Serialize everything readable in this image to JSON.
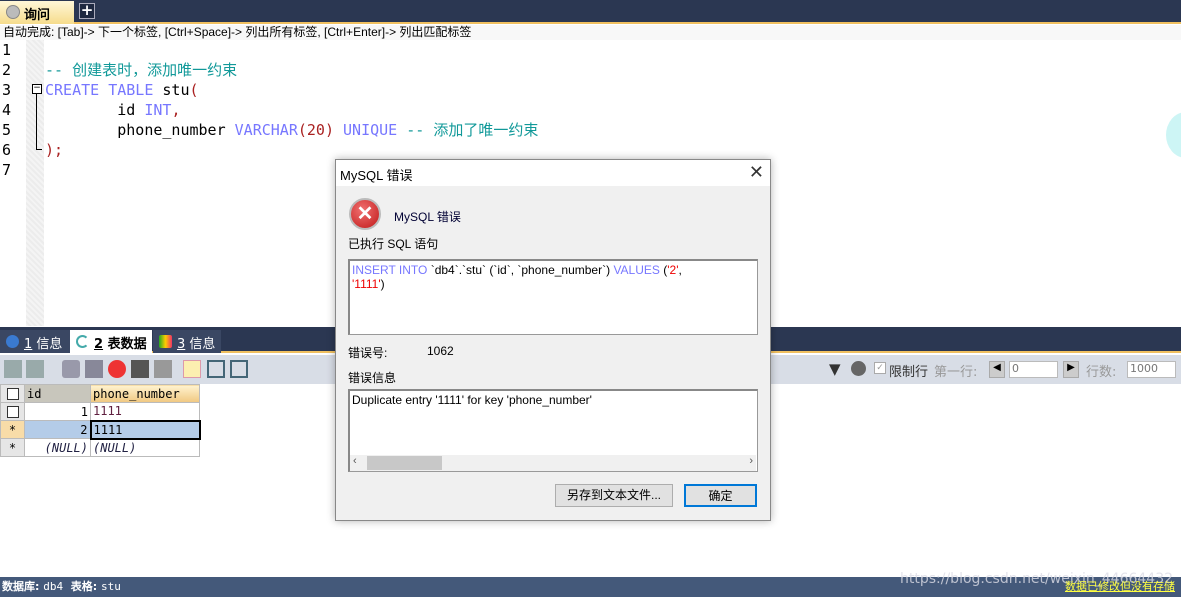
{
  "query_tab": {
    "label": "询问",
    "add_icon": "plus-icon"
  },
  "hint": "自动完成: [Tab]-> 下一个标签, [Ctrl+Space]-> 列出所有标签, [Ctrl+Enter]-> 列出匹配标签",
  "editor": {
    "line_numbers": [
      "1",
      "2",
      "3",
      "4",
      "5",
      "6",
      "7"
    ],
    "line2_comment": "-- 创建表时，添加唯一约束",
    "line3": {
      "kw": "CREATE TABLE",
      "rest": " stu",
      "paren": "("
    },
    "line4": {
      "indent": "        id ",
      "kw": "INT",
      "paren": ","
    },
    "line5": {
      "indent": "        phone_number ",
      "kw": "VARCHAR",
      "num": "(20)",
      "kw2": " UNIQUE",
      "comment": " -- 添加了唯一约束"
    },
    "line6": ");"
  },
  "result_tabs": [
    {
      "num": "1",
      "label": " 信息"
    },
    {
      "num": "2",
      "label": " 表数据"
    },
    {
      "num": "3",
      "label": " 信息"
    }
  ],
  "toolbar": {
    "limit_label": "限制行",
    "first_row_label": "第一行:",
    "first_row_value": "0",
    "rows_label": "行数:",
    "rows_value": "1000"
  },
  "grid": {
    "columns": [
      "id",
      "phone_number"
    ],
    "rows": [
      [
        "1",
        "1111"
      ],
      [
        "2",
        "1111"
      ],
      [
        "(NULL)",
        "(NULL)"
      ]
    ],
    "row_markers": [
      "",
      "*",
      "*"
    ]
  },
  "status": {
    "db_label": "数据库:",
    "db": "db4",
    "table_label": "表格:",
    "table": "stu",
    "watermark": "https://blog.csdn.net/weixin_44664432",
    "unsaved": "数据已修改但没有存储"
  },
  "dialog": {
    "title": "MySQL 错误",
    "heading": "MySQL 错误",
    "sql_label": "已执行 SQL 语句",
    "sql": {
      "kw1": "INSERT INTO",
      "p1": " `db4`.`stu` (`id`, `phone_number`) ",
      "kw2": "VALUES",
      "p2": " (",
      "v1": "'2'",
      "p3": ",",
      "v2": "'1111'",
      "p4": ")"
    },
    "errno_label": "错误号:",
    "errno": "1062",
    "msg_label": "错误信息",
    "msg": "Duplicate entry '1111' for key 'phone_number'",
    "save_button": "另存到文本文件...",
    "ok_button": "确定"
  }
}
